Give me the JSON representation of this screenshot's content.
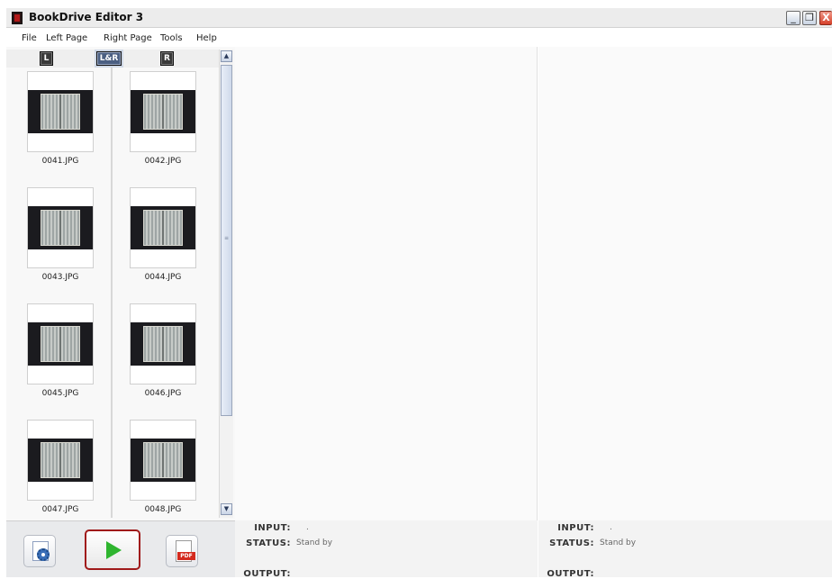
{
  "window": {
    "title": "BookDrive Editor 3",
    "minimize_glyph": "_",
    "maximize_glyph": "❐",
    "close_glyph": "X"
  },
  "menu": [
    "File",
    "Left Page",
    "Right Page",
    "Tools",
    "Help"
  ],
  "view_modes": [
    {
      "label": "L",
      "active": false
    },
    {
      "label": "L&R",
      "active": true
    },
    {
      "label": "R",
      "active": false
    }
  ],
  "thumbnails": [
    {
      "file": "0041.JPG"
    },
    {
      "file": "0042.JPG"
    },
    {
      "file": "0043.JPG"
    },
    {
      "file": "0044.JPG"
    },
    {
      "file": "0045.JPG"
    },
    {
      "file": "0046.JPG"
    },
    {
      "file": "0047.JPG"
    },
    {
      "file": "0048.JPG"
    }
  ],
  "scrollbar": {
    "up_glyph": "▲",
    "down_glyph": "▼"
  },
  "toolbar": {
    "settings_icon": "settings-doc-gear-icon",
    "run_icon": "play-icon",
    "pdf_icon": "pdf-icon",
    "pdf_label": "PDF"
  },
  "status_left": {
    "input_label": "INPUT:",
    "input_value": ".",
    "status_label": "STATUS:",
    "status_value": "Stand by",
    "output_label": "OUTPUT:"
  },
  "status_right": {
    "input_label": "INPUT:",
    "input_value": ".",
    "status_label": "STATUS:",
    "status_value": "Stand by",
    "output_label": "OUTPUT:"
  },
  "colors": {
    "run_border": "#a01a1a",
    "play": "#2fb52f",
    "active_mode": "#4b5f82"
  }
}
